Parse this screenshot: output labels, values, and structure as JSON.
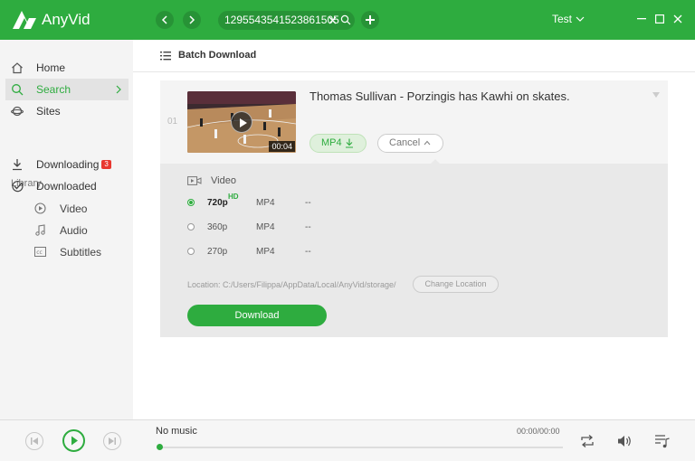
{
  "app": {
    "name": "AnyVid",
    "brand_color": "#2eac3f"
  },
  "titlebar": {
    "search_value": "1295543541523861505",
    "user": "Test",
    "icons": [
      "back-icon",
      "forward-icon",
      "clear-icon",
      "search-icon",
      "add-icon",
      "chevron-down-icon",
      "minimize-icon",
      "maximize-icon",
      "close-icon"
    ]
  },
  "sidebar": {
    "items": [
      {
        "label": "Home",
        "icon": "home-icon"
      },
      {
        "label": "Search",
        "icon": "search-icon",
        "active": true
      },
      {
        "label": "Sites",
        "icon": "planet-icon"
      }
    ],
    "library_title": "Library",
    "library": [
      {
        "label": "Downloading",
        "icon": "download-icon",
        "badge": "3"
      },
      {
        "label": "Downloaded",
        "icon": "check-circle-icon"
      }
    ],
    "sub_items": [
      {
        "label": "Video",
        "icon": "play-circle-icon"
      },
      {
        "label": "Audio",
        "icon": "music-note-icon"
      },
      {
        "label": "Subtitles",
        "icon": "cc-icon"
      }
    ]
  },
  "main": {
    "header": {
      "label": "Batch Download",
      "icon": "list-icon"
    },
    "result": {
      "index": "01",
      "title": "Thomas Sullivan - Porzingis has Kawhi on skates.",
      "duration": "00:04",
      "format_button": "MP4",
      "cancel_button": "Cancel"
    },
    "panel": {
      "section_title": "Video",
      "options": [
        {
          "resolution": "720p",
          "badge": "HD",
          "format": "MP4",
          "size": "--",
          "selected": true
        },
        {
          "resolution": "360p",
          "badge": "",
          "format": "MP4",
          "size": "--",
          "selected": false
        },
        {
          "resolution": "270p",
          "badge": "",
          "format": "MP4",
          "size": "--",
          "selected": false
        }
      ],
      "location": "Location: C:/Users/Filippa/AppData/Local/AnyVid/storage/",
      "change_location": "Change Location",
      "download_button": "Download"
    }
  },
  "player": {
    "now_playing": "No music",
    "time": "00:00/00:00",
    "progress": 0
  }
}
